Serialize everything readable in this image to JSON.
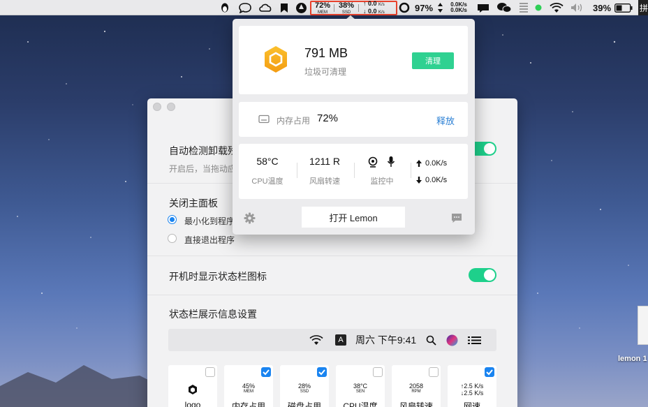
{
  "menubar": {
    "mem_value": "72%",
    "mem_label": "MEM",
    "ssd_value": "38%",
    "ssd_label": "SSD",
    "net_up": "0.0",
    "net_down": "0.0",
    "net_unit": "K/s",
    "battery_ring_percent": "97%",
    "net2_up": "0.0K/s",
    "net2_down": "0.0K/s",
    "battery": "39%",
    "ime": "拼",
    "icons": [
      "penguin-icon",
      "chat-bubble-icon",
      "cloud-icon",
      "bookmark-icon",
      "shield-icon",
      "ring-icon",
      "arrows-updown-icon",
      "messages-icon",
      "wechat-icon",
      "grid-icon",
      "green-dot-icon",
      "wifi-icon",
      "volume-icon",
      "battery-icon"
    ]
  },
  "popup": {
    "junk_size": "791 MB",
    "junk_label": "垃圾可清理",
    "clean_button": "清理",
    "memory_label": "内存占用",
    "memory_value": "72%",
    "release_link": "释放",
    "cpu_temp": "58°C",
    "cpu_temp_label": "CPU温度",
    "fan_speed": "1211 R",
    "fan_label": "风扇转速",
    "monitor_label": "监控中",
    "upload_speed": "0.0K/s",
    "download_speed": "0.0K/s",
    "open_button": "打开 Lemon"
  },
  "window": {
    "auto_detect_title": "自动检测卸载残",
    "auto_detect_desc": "开启后，当拖动应",
    "close_panel_title": "关闭主面板",
    "radio_minimize": "最小化到程序",
    "radio_exit": "直接退出程序",
    "show_statusbar_title": "开机时显示状态栏图标",
    "statusbar_settings_title": "状态栏展示信息设置",
    "preview_time": "周六 下午9:41",
    "preview_ime": "A",
    "cards": [
      {
        "label": "logo",
        "checked": false,
        "value": "",
        "sub": ""
      },
      {
        "label": "内存占用",
        "checked": true,
        "value": "45%",
        "sub": "MEM"
      },
      {
        "label": "磁盘占用",
        "checked": true,
        "value": "28%",
        "sub": "SSD"
      },
      {
        "label": "CPU温度",
        "checked": false,
        "value": "38°C",
        "sub": "SEN"
      },
      {
        "label": "风扇转速",
        "checked": false,
        "value": "2058",
        "sub": "RPM"
      },
      {
        "label": "网速",
        "checked": true,
        "value": "↑2.5 K/s",
        "sub": "↓2.5 K/s"
      }
    ]
  },
  "desktop": {
    "file_label": "lemon 1"
  },
  "colors": {
    "accent_green": "#1ed08b",
    "clean_green": "#2fd191",
    "link_blue": "#2a7fd4",
    "highlight_red": "#e8412c",
    "logo_orange": "#f5a623"
  }
}
